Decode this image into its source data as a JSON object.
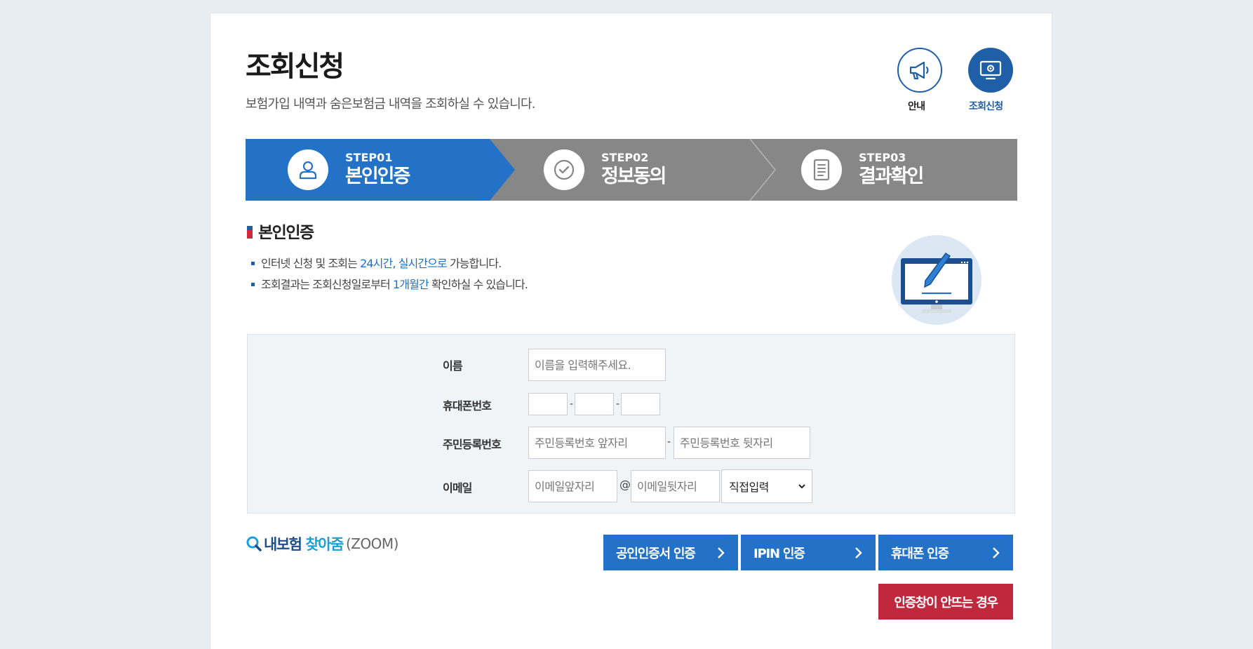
{
  "header": {
    "title": "조회신청",
    "description": "보험가입 내역과 숨은보험금 내역을 조회하실 수 있습니다."
  },
  "top_nav": {
    "guide_label": "안내",
    "inquiry_label": "조회신청"
  },
  "steps": [
    {
      "num": "STEP01",
      "name": "본인인증",
      "active": true
    },
    {
      "num": "STEP02",
      "name": "정보동의",
      "active": false
    },
    {
      "num": "STEP03",
      "name": "결과확인",
      "active": false
    }
  ],
  "section": {
    "title": "본인인증",
    "bullet1": {
      "pre": "인터넷 신청 및 조회는 ",
      "hl": "24시간, 실시간으로",
      "post": " 가능합니다."
    },
    "bullet2": {
      "pre": "조회결과는 조회신청일로부터 ",
      "hl": "1개월간",
      "post": " 확인하실 수 있습니다."
    }
  },
  "form": {
    "name_label": "이름",
    "name_placeholder": "이름을 입력해주세요.",
    "phone_label": "휴대폰번호",
    "phone_sep": "-",
    "rrn_label": "주민등록번호",
    "rrn_front_placeholder": "주민등록번호 앞자리",
    "rrn_back_placeholder": "주민등록번호 뒷자리",
    "rrn_sep": "-",
    "email_label": "이메일",
    "email_local_placeholder": "이메일앞자리",
    "email_at": "@",
    "email_domain_placeholder": "이메일뒷자리",
    "email_domain_select": "직접입력"
  },
  "logo": {
    "part1": "내보험",
    "part2": "찾아줌",
    "part3": "(ZOOM)"
  },
  "buttons": {
    "cert": "공인인증서 인증",
    "ipin": "IPIN 인증",
    "phone": "휴대폰 인증",
    "popup_help": "인증창이 안뜨는 경우"
  },
  "colors": {
    "primary": "#2472c8",
    "step_inactive": "#878787",
    "warning": "#c0283e"
  }
}
